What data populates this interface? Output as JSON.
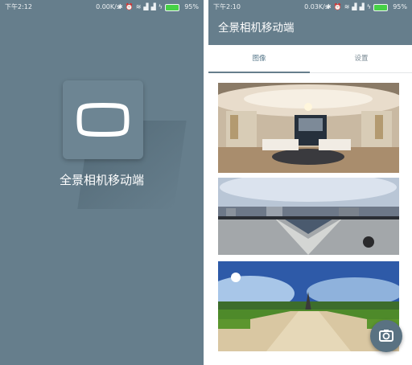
{
  "left_screen": {
    "status_bar": {
      "time": "下午2:12",
      "speed": "0.00K/s",
      "battery": "95%"
    },
    "app_title": "全景相机移动端",
    "app_icon": "tv-screen-icon"
  },
  "right_screen": {
    "status_bar": {
      "time": "下午2:10",
      "speed": "0.03K/s",
      "battery": "95%"
    },
    "app_title": "全景相机移动端",
    "tabs": [
      {
        "label": "图像",
        "selected": true
      },
      {
        "label": "设置",
        "selected": false
      }
    ],
    "fab_icon": "camera-icon"
  },
  "colors": {
    "primary": "#667e8c",
    "fab": "#5a7282",
    "battery": "#47d147"
  }
}
